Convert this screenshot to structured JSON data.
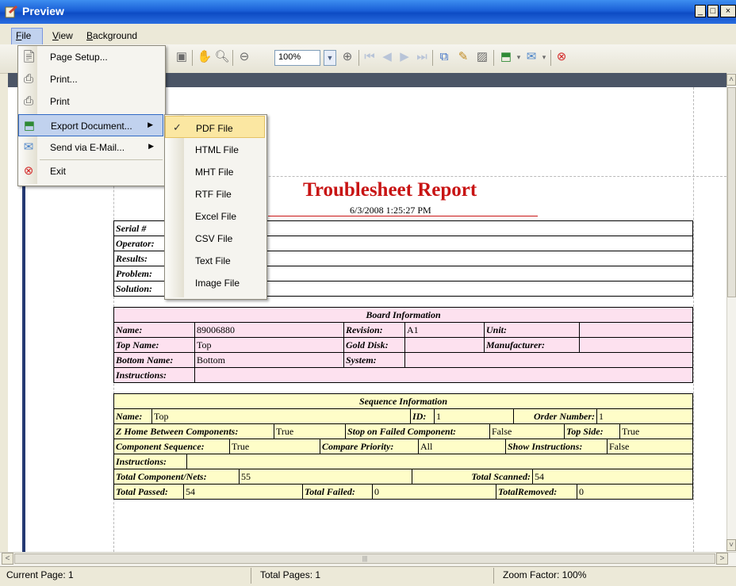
{
  "window": {
    "title": "Preview",
    "min": "_",
    "max": "□",
    "close": "×"
  },
  "menubar": {
    "file": "File",
    "file_u": "F",
    "file_rest": "ile",
    "view_u": "V",
    "view_rest": "iew",
    "background_u": "B",
    "background_rest": "ackground"
  },
  "toolbar": {
    "zoom": "100%"
  },
  "file_menu": [
    {
      "label": "Page Setup...",
      "icon": "page-setup-icon"
    },
    {
      "label": "Print...",
      "icon": "print-dialog-icon"
    },
    {
      "label": "Print",
      "icon": "printer-icon"
    },
    {
      "label": "Export Document...",
      "icon": "export-icon",
      "submenu": true
    },
    {
      "label": "Send via E-Mail...",
      "icon": "email-icon",
      "submenu": true
    },
    {
      "label": "Exit",
      "icon": "exit-icon"
    }
  ],
  "export_menu": [
    {
      "label": "PDF File",
      "checked": true
    },
    {
      "label": "HTML File"
    },
    {
      "label": "MHT File"
    },
    {
      "label": "RTF File"
    },
    {
      "label": "Excel File"
    },
    {
      "label": "CSV File"
    },
    {
      "label": "Text File"
    },
    {
      "label": "Image File"
    }
  ],
  "report": {
    "title": "Troublesheet Report",
    "date": "6/3/2008 1:25:27 PM",
    "top_labels": [
      "Serial #",
      "Operator:",
      "Results:",
      "Problem:",
      "Solution:"
    ],
    "board": {
      "header": "Board Information",
      "name_label": "Name:",
      "name": "89006880",
      "revision_label": "Revision:",
      "revision": "A1",
      "unit_label": "Unit:",
      "unit": "",
      "top_name_label": "Top Name:",
      "top_name": "Top",
      "gold_disk_label": "Gold Disk:",
      "manufacturer_label": "Manufacturer:",
      "bottom_name_label": "Bottom Name:",
      "bottom_name": "Bottom",
      "system_label": "System:",
      "instructions_label": "Instructions:"
    },
    "sequence": {
      "header": "Sequence Information",
      "name_label": "Name:",
      "name": "Top",
      "id_label": "ID:",
      "id": "1",
      "order_label": "Order Number:",
      "order": "1",
      "zhome_label": "Z Home Between Components:",
      "zhome": "True",
      "stop_label": "Stop on Failed Component:",
      "stop": "False",
      "topside_label": "Top Side:",
      "topside": "True",
      "compseq_label": "Component Sequence:",
      "compseq": "True",
      "priority_label": "Compare Priority:",
      "priority": "All",
      "showinst_label": "Show Instructions:",
      "showinst": "False",
      "instructions_label": "Instructions:",
      "total_comp_label": "Total Component/Nets:",
      "total_comp": "55",
      "total_scanned_label": "Total Scanned:",
      "total_scanned": "54",
      "passed_label": "Total Passed:",
      "passed": "54",
      "failed_label": "Total Failed:",
      "failed": "0",
      "removed_label": "TotalRemoved:",
      "removed": "0"
    }
  },
  "status": {
    "current_page": "Current Page: 1",
    "total_pages": "Total Pages: 1",
    "zoom_factor": "Zoom Factor: 100%"
  },
  "colors": {
    "title_red": "#c81414",
    "board_pink": "#fde1ef",
    "sequence_yellow": "#fefdc8",
    "menu_highlight": "#c1d2ee"
  }
}
